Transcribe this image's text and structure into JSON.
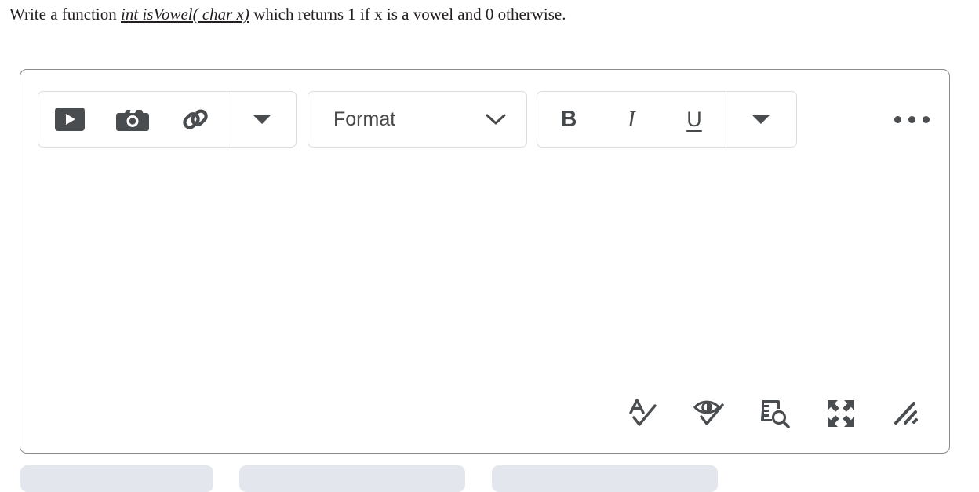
{
  "prompt": {
    "before": "Write a function ",
    "code": "int isVowel( char x)",
    "after": " which returns 1 if x is a vowel and 0 otherwise."
  },
  "colors": {
    "icon": "#4a4d50",
    "container_border": "#8a8d8f",
    "group_border": "#dcdcdc",
    "pill": "#e3e7ed",
    "text": "#231f20"
  },
  "editor": {
    "body_text": "",
    "toolbar": {
      "insert_group": {
        "buttons": [
          {
            "name": "insert-video",
            "icon": "video-icon",
            "label": "Insert video"
          },
          {
            "name": "insert-image",
            "icon": "camera-icon",
            "label": "Insert image"
          },
          {
            "name": "insert-link",
            "icon": "link-icon",
            "label": "Insert link"
          }
        ],
        "more_label": "More insert options",
        "more_icon": "caret-down-icon"
      },
      "format_select": {
        "label": "Format",
        "icon": "chevron-down-icon"
      },
      "text_style_group": {
        "buttons": [
          {
            "name": "bold",
            "icon": "bold-icon",
            "label": "B"
          },
          {
            "name": "italic",
            "icon": "italic-icon",
            "label": "I"
          },
          {
            "name": "underline",
            "icon": "underline-icon",
            "label": "U"
          }
        ],
        "more_label": "More text options",
        "more_icon": "caret-down-icon"
      },
      "overflow": {
        "label": "More options",
        "icon": "ellipsis-icon"
      }
    },
    "status_bar": {
      "buttons": [
        {
          "name": "spell-check",
          "icon": "spellcheck-icon",
          "label": "Check spelling"
        },
        {
          "name": "accessibility-check",
          "icon": "eye-check-icon",
          "label": "Accessibility checker"
        },
        {
          "name": "document-preview",
          "icon": "document-search-icon",
          "label": "Preview document"
        },
        {
          "name": "fullscreen",
          "icon": "expand-arrows-icon",
          "label": "Toggle fullscreen"
        },
        {
          "name": "resize-grip",
          "icon": "resize-grip-icon",
          "label": "Resize editor"
        }
      ]
    }
  },
  "footer": {
    "buttons": [
      {
        "name": "footer-button-1",
        "label": ""
      },
      {
        "name": "footer-button-2",
        "label": ""
      },
      {
        "name": "footer-button-3",
        "label": ""
      }
    ]
  }
}
